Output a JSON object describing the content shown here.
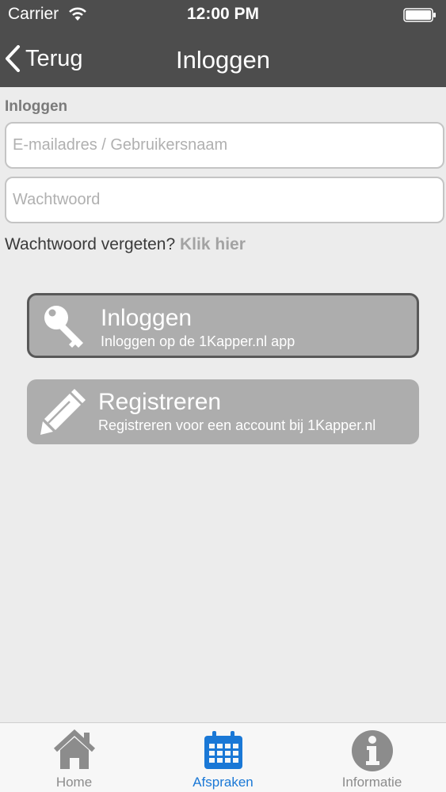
{
  "status_bar": {
    "carrier": "Carrier",
    "time": "12:00 PM"
  },
  "nav": {
    "back_label": "Terug",
    "title": "Inloggen"
  },
  "form": {
    "section_title": "Inloggen",
    "email_placeholder": "E-mailadres / Gebruikersnaam",
    "email_value": "",
    "password_placeholder": "Wachtwoord",
    "password_value": "",
    "forgot_text": "Wachtwoord vergeten?",
    "forgot_link": "Klik hier"
  },
  "buttons": {
    "login": {
      "title": "Inloggen",
      "subtitle": "Inloggen op de 1Kapper.nl app",
      "icon": "key-icon"
    },
    "register": {
      "title": "Registreren",
      "subtitle": "Registreren voor een account bij 1Kapper.nl",
      "icon": "pencil-icon"
    }
  },
  "tabbar": {
    "items": [
      {
        "label": "Home",
        "icon": "home-icon",
        "active": false
      },
      {
        "label": "Afspraken",
        "icon": "calendar-icon",
        "active": true
      },
      {
        "label": "Informatie",
        "icon": "info-icon",
        "active": false
      }
    ]
  },
  "colors": {
    "nav_background": "#4d4d4d",
    "page_background": "#ececec",
    "button_background": "#adadad",
    "active_tab": "#1a78d6",
    "inactive_tab": "#8c8c8c"
  }
}
